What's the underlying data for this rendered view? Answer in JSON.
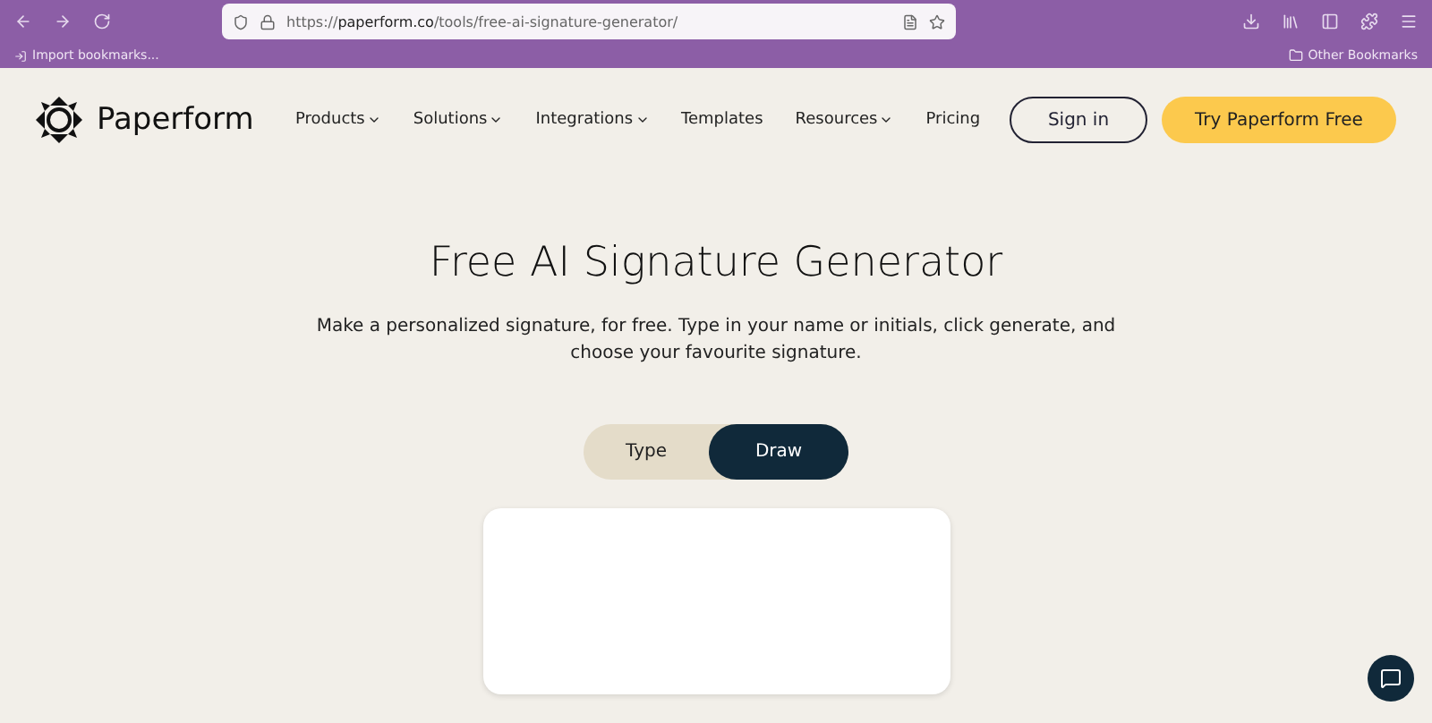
{
  "browser": {
    "url_host": "paperform.co",
    "url_path": "/tools/free-ai-signature-generator/",
    "url_scheme": "https://",
    "bookmarks": [
      "Import bookmarks..."
    ],
    "other_bookmarks": "Other Bookmarks"
  },
  "site": {
    "logo": "Paperform",
    "nav": [
      {
        "label": "Products",
        "dropdown": true
      },
      {
        "label": "Solutions",
        "dropdown": true
      },
      {
        "label": "Integrations",
        "dropdown": true
      },
      {
        "label": "Templates",
        "dropdown": false
      },
      {
        "label": "Resources",
        "dropdown": true
      },
      {
        "label": "Pricing",
        "dropdown": false
      }
    ],
    "sign_in": "Sign in",
    "cta": "Try Paperform Free"
  },
  "hero": {
    "title": "Free AI Signature Generator",
    "subtitle": "Make a personalized signature, for free. Type in your name or initials, click generate, and choose your favourite signature.",
    "modes": [
      {
        "label": "Type",
        "selected": false
      },
      {
        "label": "Draw",
        "selected": true
      }
    ]
  }
}
